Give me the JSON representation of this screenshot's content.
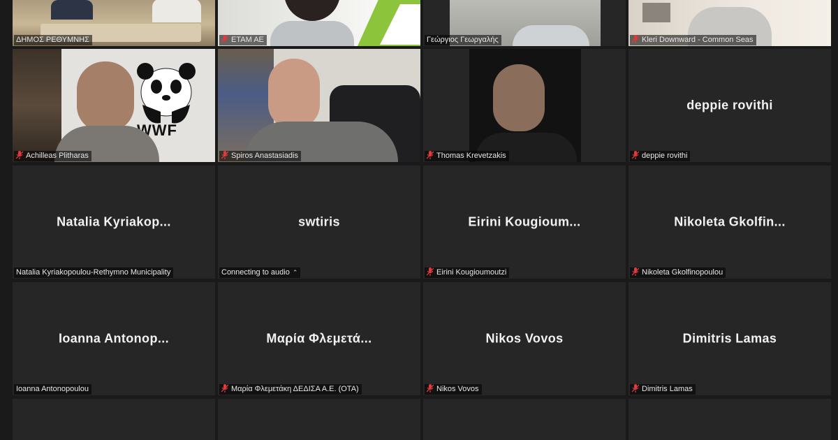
{
  "colors": {
    "background": "#1a1a1a",
    "tile": "#262626",
    "active_speaker_border": "#e6d33a",
    "muted_mic": "#e0393e"
  },
  "participants": [
    {
      "tag": "ΔΗΜΟΣ ΡΕΘΥΜΝΗΣ",
      "muted": false,
      "video": true,
      "active": true
    },
    {
      "tag": "ΕΤΑΜ ΑΕ",
      "muted": true,
      "video": true
    },
    {
      "tag": "Γεώργιος Γεωργαλής",
      "muted": false,
      "video": true
    },
    {
      "tag": "Kleri Downward - Common Seas",
      "muted": true,
      "video": true
    },
    {
      "tag": "Achilleas Plitharas",
      "muted": true,
      "video": true,
      "backdrop_text": "WWF"
    },
    {
      "tag": "Spiros Anastasiadis",
      "muted": true,
      "video": true
    },
    {
      "tag": "Thomas Krevetzakis",
      "muted": true,
      "video": true
    },
    {
      "display": "deppie rovithi",
      "tag": "deppie rovithi",
      "muted": true,
      "video": false
    },
    {
      "display": "Natalia  Kyriakop...",
      "tag": "Natalia Kyriakopoulou-Rethymno Municipality",
      "muted": false,
      "video": false
    },
    {
      "display": "swtiris",
      "tag": "Connecting to audio",
      "muted": false,
      "video": false,
      "connecting": true
    },
    {
      "display": "Eirini  Kougioum...",
      "tag": "Eirini Kougioumoutzi",
      "muted": true,
      "video": false
    },
    {
      "display": "Nikoleta  Gkolfin...",
      "tag": "Nikoleta Gkolfinopoulou",
      "muted": true,
      "video": false
    },
    {
      "display": "Ioanna  Antonop...",
      "tag": "Ioanna Antonopoulou",
      "muted": false,
      "video": false
    },
    {
      "display": "Μαρία  Φλεμετά...",
      "tag": "Μαρία Φλεμετάκη ΔΕΔΙΣΑ Α.Ε. (ΟΤΑ)",
      "muted": true,
      "video": false
    },
    {
      "display": "Nikos Vovos",
      "tag": "Nikos Vovos",
      "muted": true,
      "video": false
    },
    {
      "display": "Dimitris Lamas",
      "tag": "Dimitris Lamas",
      "muted": true,
      "video": false
    }
  ]
}
